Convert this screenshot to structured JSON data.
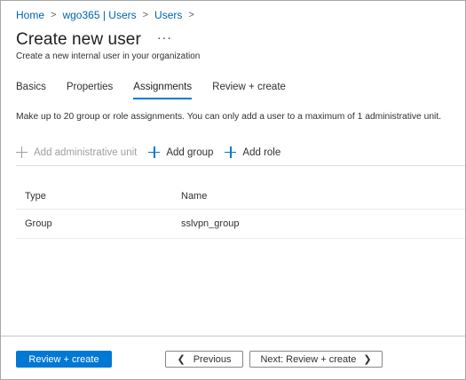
{
  "breadcrumb": {
    "items": [
      "Home",
      "wgo365 | Users",
      "Users"
    ],
    "separator": ">"
  },
  "header": {
    "title": "Create new user",
    "more_label": "···",
    "subtitle": "Create a new internal user in your organization"
  },
  "tabs": [
    {
      "label": "Basics",
      "active": false
    },
    {
      "label": "Properties",
      "active": false
    },
    {
      "label": "Assignments",
      "active": true
    },
    {
      "label": "Review + create",
      "active": false
    }
  ],
  "info_text": "Make up to 20 group or role assignments. You can only add a user to a maximum of 1 administrative unit.",
  "commands": {
    "add_admin_unit": {
      "label": "Add administrative unit",
      "enabled": false
    },
    "add_group": {
      "label": "Add group",
      "enabled": true
    },
    "add_role": {
      "label": "Add role",
      "enabled": true
    }
  },
  "table": {
    "columns": [
      "Type",
      "Name"
    ],
    "rows": [
      {
        "type": "Group",
        "name": "sslvpn_group"
      }
    ]
  },
  "footer": {
    "primary_label": "Review + create",
    "previous_label": "Previous",
    "next_label": "Next: Review + create"
  },
  "icons": {
    "breadcrumb_separator": "chevron-right-icon",
    "add": "plus-icon",
    "previous": "chevron-left-icon",
    "next": "chevron-right-icon"
  },
  "colors": {
    "accent": "#0078d4",
    "link": "#0063b1",
    "disabled": "#a19f9d"
  }
}
